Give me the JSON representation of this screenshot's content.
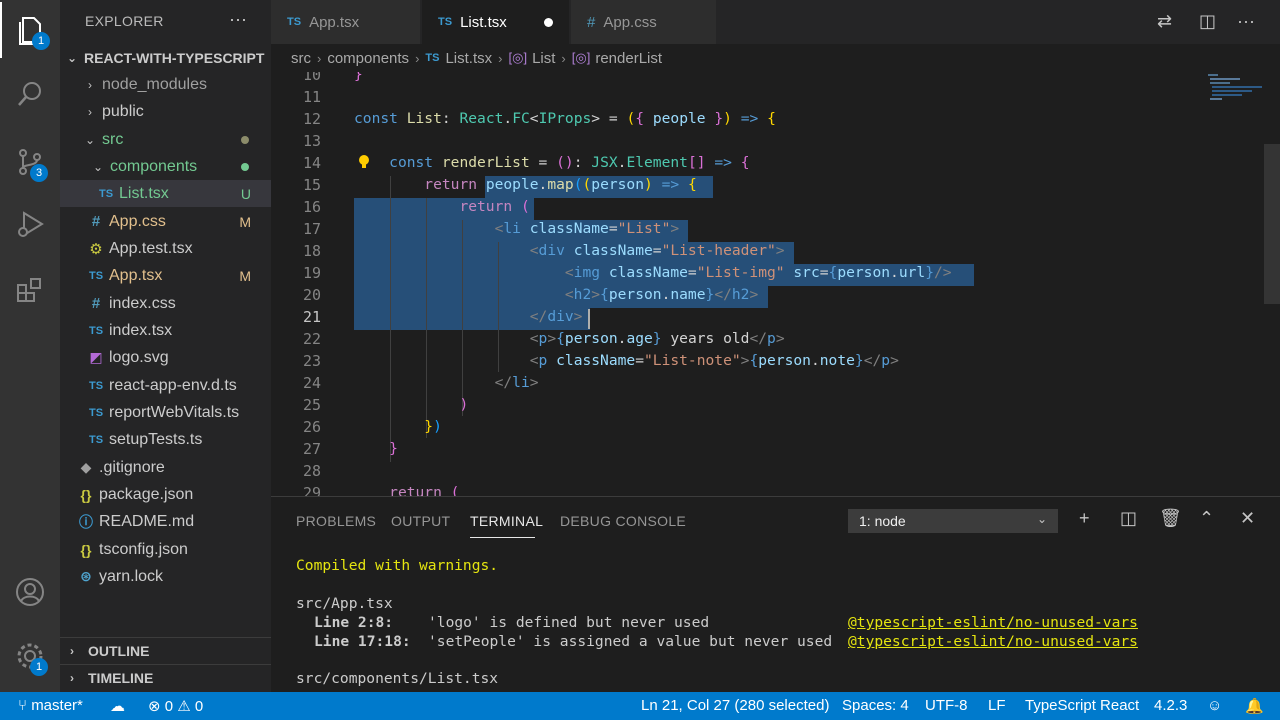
{
  "activity_bar": {
    "explorer_badge": "1",
    "scm_badge": "3",
    "settings_badge": "1"
  },
  "sidebar": {
    "title": "EXPLORER",
    "more": "···",
    "root": "REACT-WITH-TYPESCRIPT",
    "tree": [
      {
        "name": "node_modules",
        "kind": "folder",
        "expanded": false
      },
      {
        "name": "public",
        "kind": "folder",
        "expanded": false
      },
      {
        "name": "src",
        "kind": "folder",
        "expanded": true
      },
      {
        "name": "components",
        "kind": "folder",
        "expanded": true
      },
      {
        "name": "List.tsx",
        "kind": "file",
        "status": "U"
      },
      {
        "name": "App.css",
        "kind": "file",
        "status": "M"
      },
      {
        "name": "App.test.tsx",
        "kind": "file"
      },
      {
        "name": "App.tsx",
        "kind": "file",
        "status": "M"
      },
      {
        "name": "index.css",
        "kind": "file"
      },
      {
        "name": "index.tsx",
        "kind": "file"
      },
      {
        "name": "logo.svg",
        "kind": "file"
      },
      {
        "name": "react-app-env.d.ts",
        "kind": "file"
      },
      {
        "name": "reportWebVitals.ts",
        "kind": "file"
      },
      {
        "name": "setupTests.ts",
        "kind": "file"
      },
      {
        "name": ".gitignore",
        "kind": "file"
      },
      {
        "name": "package.json",
        "kind": "file"
      },
      {
        "name": "README.md",
        "kind": "file"
      },
      {
        "name": "tsconfig.json",
        "kind": "file"
      },
      {
        "name": "yarn.lock",
        "kind": "file"
      }
    ],
    "outline": "OUTLINE",
    "timeline": "TIMELINE"
  },
  "tabs": [
    {
      "label": "App.tsx",
      "icon": "TS"
    },
    {
      "label": "List.tsx",
      "icon": "TS",
      "active": true,
      "dirty": true
    },
    {
      "label": "App.css",
      "icon": "#"
    }
  ],
  "breadcrumb": [
    "src",
    "components",
    "List.tsx",
    "List",
    "renderList"
  ],
  "editor": {
    "lines": [
      "10",
      "11",
      "12",
      "13",
      "14",
      "15",
      "16",
      "17",
      "18",
      "19",
      "20",
      "21",
      "22",
      "23",
      "24",
      "25",
      "26",
      "27",
      "28",
      "29"
    ]
  },
  "panel": {
    "tabs": [
      "PROBLEMS",
      "OUTPUT",
      "TERMINAL",
      "DEBUG CONSOLE"
    ],
    "terminal_select": "1: node",
    "output": {
      "compiled": "Compiled with warnings.",
      "file1": "src/App.tsx",
      "w1_loc": "Line 2:8:",
      "w1_msg": "'logo' is defined but never used",
      "w1_rule": "@typescript-eslint/no-unused-vars",
      "w2_loc": "Line 17:18:",
      "w2_msg": "'setPeople' is assigned a value but never used",
      "w2_rule": "@typescript-eslint/no-unused-vars",
      "file2": "src/components/List.tsx"
    }
  },
  "statusbar": {
    "branch": "master*",
    "errors": "0",
    "warnings": "0",
    "position": "Ln 21, Col 27 (280 selected)",
    "spaces": "Spaces: 4",
    "encoding": "UTF-8",
    "eol": "LF",
    "language": "TypeScript React",
    "version": "4.2.3"
  },
  "colors": {
    "accent": "#007acc",
    "selection": "#264f78",
    "modified": "#e2c08d",
    "untracked": "#73c991"
  }
}
